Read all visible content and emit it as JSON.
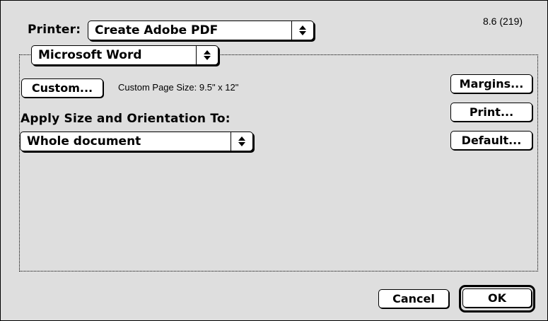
{
  "header": {
    "printer_label": "Printer:",
    "printer_value": "Create Adobe PDF",
    "version": "8.6 (219)"
  },
  "section": {
    "app_value": "Microsoft Word",
    "custom_button": "Custom...",
    "custom_size_text": "Custom Page Size: 9.5\" x 12\"",
    "apply_label": "Apply Size and Orientation To:",
    "apply_value": "Whole document"
  },
  "side_buttons": {
    "margins": "Margins...",
    "print": "Print...",
    "default": "Default..."
  },
  "footer": {
    "cancel": "Cancel",
    "ok": "OK"
  },
  "icons": {
    "popup_arrows": "up-down-arrows-icon"
  }
}
